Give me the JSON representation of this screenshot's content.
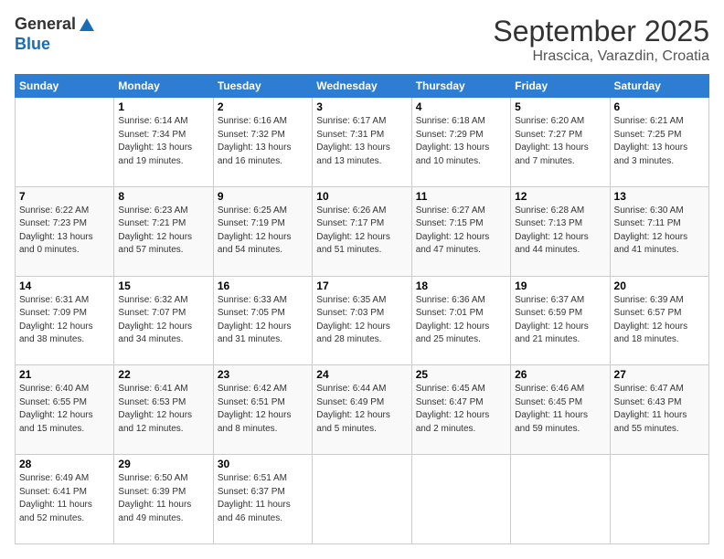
{
  "header": {
    "logo_line1": "General",
    "logo_line2": "Blue",
    "month": "September 2025",
    "location": "Hrascica, Varazdin, Croatia"
  },
  "days_of_week": [
    "Sunday",
    "Monday",
    "Tuesday",
    "Wednesday",
    "Thursday",
    "Friday",
    "Saturday"
  ],
  "weeks": [
    [
      {
        "num": "",
        "info": ""
      },
      {
        "num": "1",
        "info": "Sunrise: 6:14 AM\nSunset: 7:34 PM\nDaylight: 13 hours\nand 19 minutes."
      },
      {
        "num": "2",
        "info": "Sunrise: 6:16 AM\nSunset: 7:32 PM\nDaylight: 13 hours\nand 16 minutes."
      },
      {
        "num": "3",
        "info": "Sunrise: 6:17 AM\nSunset: 7:31 PM\nDaylight: 13 hours\nand 13 minutes."
      },
      {
        "num": "4",
        "info": "Sunrise: 6:18 AM\nSunset: 7:29 PM\nDaylight: 13 hours\nand 10 minutes."
      },
      {
        "num": "5",
        "info": "Sunrise: 6:20 AM\nSunset: 7:27 PM\nDaylight: 13 hours\nand 7 minutes."
      },
      {
        "num": "6",
        "info": "Sunrise: 6:21 AM\nSunset: 7:25 PM\nDaylight: 13 hours\nand 3 minutes."
      }
    ],
    [
      {
        "num": "7",
        "info": "Sunrise: 6:22 AM\nSunset: 7:23 PM\nDaylight: 13 hours\nand 0 minutes."
      },
      {
        "num": "8",
        "info": "Sunrise: 6:23 AM\nSunset: 7:21 PM\nDaylight: 12 hours\nand 57 minutes."
      },
      {
        "num": "9",
        "info": "Sunrise: 6:25 AM\nSunset: 7:19 PM\nDaylight: 12 hours\nand 54 minutes."
      },
      {
        "num": "10",
        "info": "Sunrise: 6:26 AM\nSunset: 7:17 PM\nDaylight: 12 hours\nand 51 minutes."
      },
      {
        "num": "11",
        "info": "Sunrise: 6:27 AM\nSunset: 7:15 PM\nDaylight: 12 hours\nand 47 minutes."
      },
      {
        "num": "12",
        "info": "Sunrise: 6:28 AM\nSunset: 7:13 PM\nDaylight: 12 hours\nand 44 minutes."
      },
      {
        "num": "13",
        "info": "Sunrise: 6:30 AM\nSunset: 7:11 PM\nDaylight: 12 hours\nand 41 minutes."
      }
    ],
    [
      {
        "num": "14",
        "info": "Sunrise: 6:31 AM\nSunset: 7:09 PM\nDaylight: 12 hours\nand 38 minutes."
      },
      {
        "num": "15",
        "info": "Sunrise: 6:32 AM\nSunset: 7:07 PM\nDaylight: 12 hours\nand 34 minutes."
      },
      {
        "num": "16",
        "info": "Sunrise: 6:33 AM\nSunset: 7:05 PM\nDaylight: 12 hours\nand 31 minutes."
      },
      {
        "num": "17",
        "info": "Sunrise: 6:35 AM\nSunset: 7:03 PM\nDaylight: 12 hours\nand 28 minutes."
      },
      {
        "num": "18",
        "info": "Sunrise: 6:36 AM\nSunset: 7:01 PM\nDaylight: 12 hours\nand 25 minutes."
      },
      {
        "num": "19",
        "info": "Sunrise: 6:37 AM\nSunset: 6:59 PM\nDaylight: 12 hours\nand 21 minutes."
      },
      {
        "num": "20",
        "info": "Sunrise: 6:39 AM\nSunset: 6:57 PM\nDaylight: 12 hours\nand 18 minutes."
      }
    ],
    [
      {
        "num": "21",
        "info": "Sunrise: 6:40 AM\nSunset: 6:55 PM\nDaylight: 12 hours\nand 15 minutes."
      },
      {
        "num": "22",
        "info": "Sunrise: 6:41 AM\nSunset: 6:53 PM\nDaylight: 12 hours\nand 12 minutes."
      },
      {
        "num": "23",
        "info": "Sunrise: 6:42 AM\nSunset: 6:51 PM\nDaylight: 12 hours\nand 8 minutes."
      },
      {
        "num": "24",
        "info": "Sunrise: 6:44 AM\nSunset: 6:49 PM\nDaylight: 12 hours\nand 5 minutes."
      },
      {
        "num": "25",
        "info": "Sunrise: 6:45 AM\nSunset: 6:47 PM\nDaylight: 12 hours\nand 2 minutes."
      },
      {
        "num": "26",
        "info": "Sunrise: 6:46 AM\nSunset: 6:45 PM\nDaylight: 11 hours\nand 59 minutes."
      },
      {
        "num": "27",
        "info": "Sunrise: 6:47 AM\nSunset: 6:43 PM\nDaylight: 11 hours\nand 55 minutes."
      }
    ],
    [
      {
        "num": "28",
        "info": "Sunrise: 6:49 AM\nSunset: 6:41 PM\nDaylight: 11 hours\nand 52 minutes."
      },
      {
        "num": "29",
        "info": "Sunrise: 6:50 AM\nSunset: 6:39 PM\nDaylight: 11 hours\nand 49 minutes."
      },
      {
        "num": "30",
        "info": "Sunrise: 6:51 AM\nSunset: 6:37 PM\nDaylight: 11 hours\nand 46 minutes."
      },
      {
        "num": "",
        "info": ""
      },
      {
        "num": "",
        "info": ""
      },
      {
        "num": "",
        "info": ""
      },
      {
        "num": "",
        "info": ""
      }
    ]
  ]
}
